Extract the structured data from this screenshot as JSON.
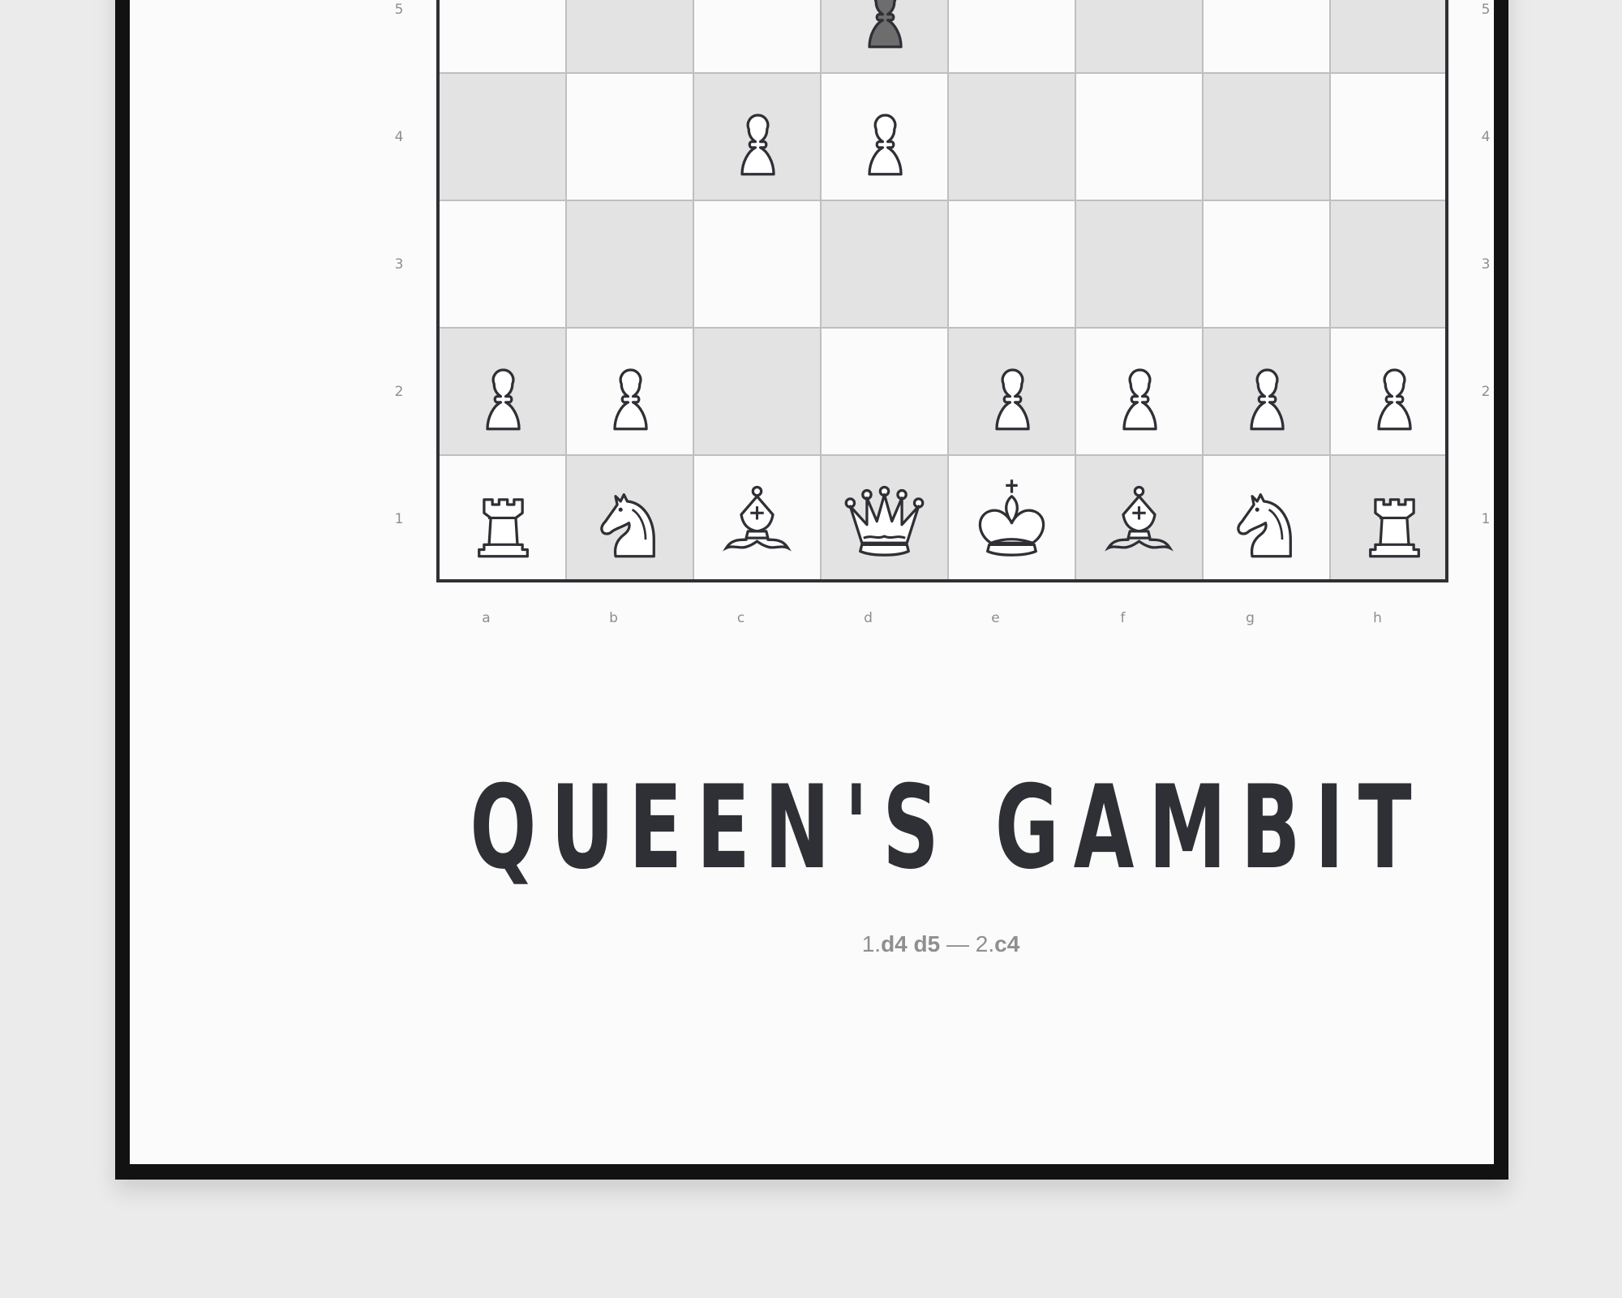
{
  "poster": {
    "title": "QUEEN'S GAMBIT",
    "moves": [
      {
        "num": "1.",
        "white": "d4",
        "black": "d5"
      },
      {
        "num": "2.",
        "white": "c4"
      }
    ],
    "moves_separator": " — "
  },
  "board": {
    "files": [
      "a",
      "b",
      "c",
      "d",
      "e",
      "f",
      "g",
      "h"
    ],
    "visible_ranks": [
      "5",
      "4",
      "3",
      "2",
      "1"
    ],
    "colors": {
      "light_square": "#fbfbfb",
      "dark_square": "#e3e3e3",
      "white_piece": "#ffffff",
      "black_piece": "#6d6d6d",
      "outline": "#2f3035"
    },
    "pieces": [
      {
        "square": "d5",
        "piece": "pawn",
        "color": "black"
      },
      {
        "square": "c4",
        "piece": "pawn",
        "color": "white"
      },
      {
        "square": "d4",
        "piece": "pawn",
        "color": "white"
      },
      {
        "square": "a2",
        "piece": "pawn",
        "color": "white"
      },
      {
        "square": "b2",
        "piece": "pawn",
        "color": "white"
      },
      {
        "square": "e2",
        "piece": "pawn",
        "color": "white"
      },
      {
        "square": "f2",
        "piece": "pawn",
        "color": "white"
      },
      {
        "square": "g2",
        "piece": "pawn",
        "color": "white"
      },
      {
        "square": "h2",
        "piece": "pawn",
        "color": "white"
      },
      {
        "square": "a1",
        "piece": "rook",
        "color": "white"
      },
      {
        "square": "b1",
        "piece": "knight",
        "color": "white"
      },
      {
        "square": "c1",
        "piece": "bishop",
        "color": "white"
      },
      {
        "square": "d1",
        "piece": "queen",
        "color": "white"
      },
      {
        "square": "e1",
        "piece": "king",
        "color": "white"
      },
      {
        "square": "f1",
        "piece": "bishop",
        "color": "white"
      },
      {
        "square": "g1",
        "piece": "knight",
        "color": "white"
      },
      {
        "square": "h1",
        "piece": "rook",
        "color": "white"
      }
    ]
  }
}
